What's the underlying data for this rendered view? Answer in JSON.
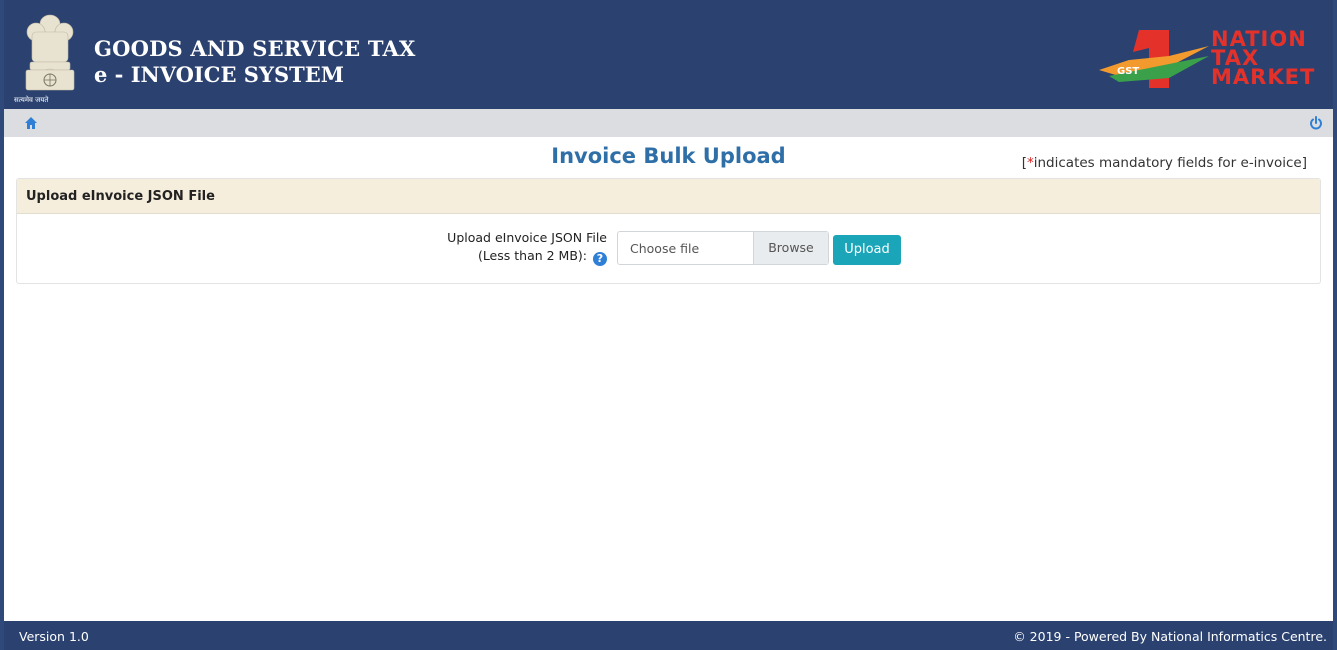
{
  "header": {
    "title_line1": "GOODS AND SERVICE TAX",
    "title_line2": "e - INVOICE SYSTEM",
    "motto": "सत्यमेव जयते",
    "logo_text": [
      "NATION",
      "TAX",
      "MARKET"
    ],
    "logo_badge": "GST",
    "colors": {
      "header_bg": "#2b4270",
      "logo_red": "#e4322b"
    }
  },
  "navbar": {
    "home_icon": "home-icon",
    "power_icon": "power-icon",
    "icon_color": "#2f7fd6"
  },
  "page": {
    "title": "Invoice Bulk Upload",
    "mandatory_note_open": "[",
    "mandatory_star": "*",
    "mandatory_note_text": "indicates mandatory fields for e-invoice]"
  },
  "panel": {
    "heading": "Upload eInvoice JSON File",
    "field_label_line1": "Upload eInvoice JSON File",
    "field_label_line2": "(Less than 2 MB):",
    "help_icon": "?",
    "file_placeholder": "Choose file",
    "browse_label": "Browse",
    "upload_label": "Upload"
  },
  "footer": {
    "version": "Version 1.0",
    "copyright": "© 2019 - Powered By National Informatics Centre."
  }
}
